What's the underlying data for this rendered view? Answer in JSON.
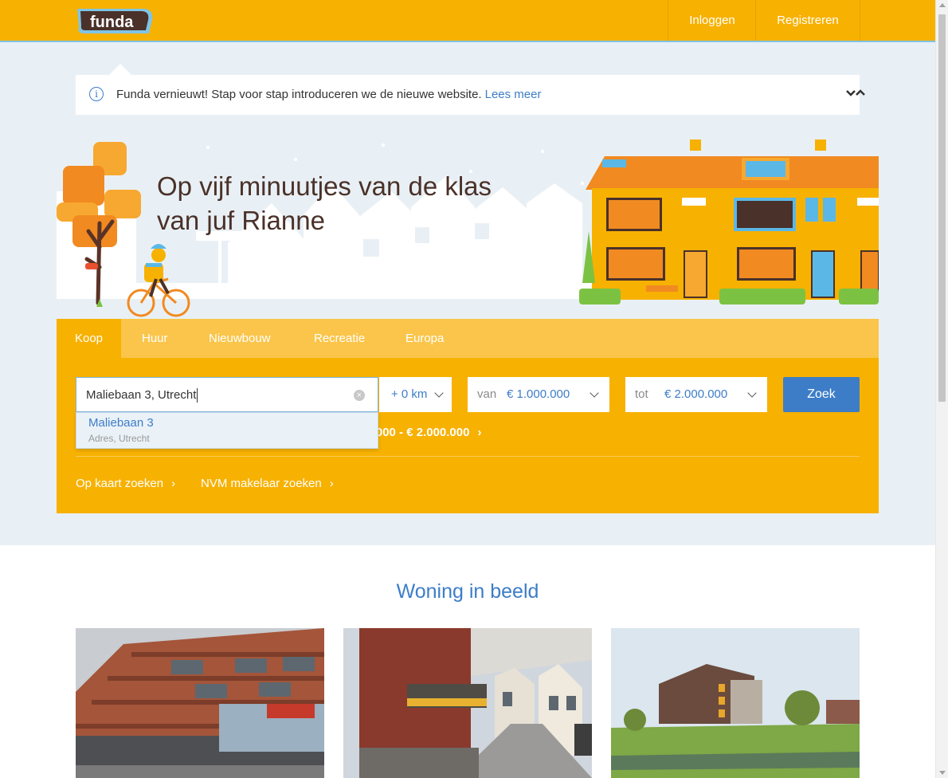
{
  "header": {
    "logo_text": "funda",
    "login_label": "Inloggen",
    "register_label": "Registreren"
  },
  "notice": {
    "text": "Funda vernieuwt! Stap voor stap introduceren we de nieuwe website.",
    "link": "Lees meer"
  },
  "hero": {
    "title_line1": "Op vijf minuutjes van de klas",
    "title_line2": "van juf Rianne"
  },
  "tabs": [
    {
      "label": "Koop",
      "active": true
    },
    {
      "label": "Huur"
    },
    {
      "label": "Nieuwbouw"
    },
    {
      "label": "Recreatie"
    },
    {
      "label": "Europa"
    }
  ],
  "search": {
    "location_value": "Maliebaan 3, Utrecht",
    "radius_value": "+ 0 km",
    "from_prefix": "van",
    "from_value": "€ 1.000.000",
    "to_prefix": "tot",
    "to_value": "€ 2.000.000",
    "button_label": "Zoek",
    "recent_search": "00.000 - € 2.000.000"
  },
  "autocomplete": {
    "title": "Maliebaan 3",
    "subtitle": "Adres, Utrecht"
  },
  "links": {
    "map_search": "Op kaart zoeken",
    "nvm_search": "NVM makelaar zoeken"
  },
  "featured": {
    "title": "Woning in beeld"
  },
  "colors": {
    "brand_yellow": "#f7b100",
    "brand_blue": "#3d7dc8",
    "title_brown": "#4a3129"
  }
}
